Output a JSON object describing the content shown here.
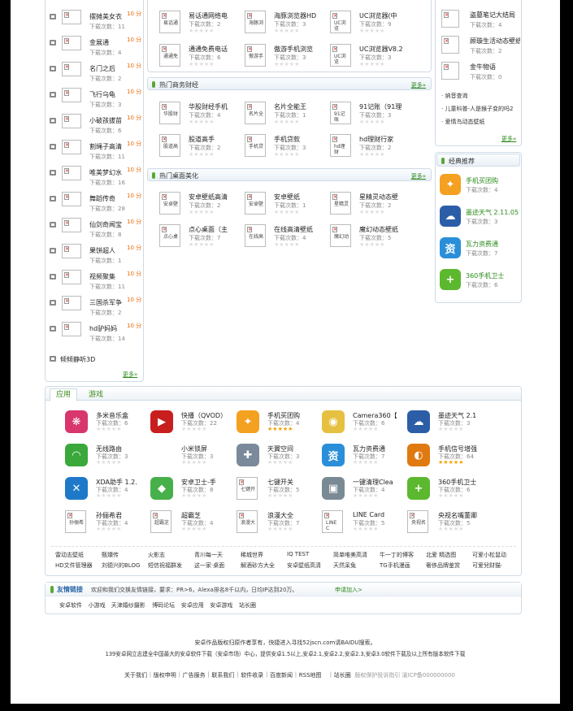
{
  "labels": {
    "hot": "10 分",
    "more": "更多»",
    "count_prefix": "下载次数：",
    "stars_glyph": "★★★★★"
  },
  "left_list": [
    {
      "name": "摆摊美女衣",
      "count": "11",
      "hot": true
    },
    {
      "name": "金展通",
      "count": "4",
      "hot": true
    },
    {
      "name": "名门之后",
      "count": "2",
      "hot": true
    },
    {
      "name": "飞行乌龟",
      "count": "3",
      "hot": true
    },
    {
      "name": "小破孩拔苗",
      "count": "6",
      "hot": true
    },
    {
      "name": "割绳子高清",
      "count": "11",
      "hot": true
    },
    {
      "name": "唯美梦幻水",
      "count": "16",
      "hot": true
    },
    {
      "name": "舞蹈传奇",
      "count": "28",
      "hot": true
    },
    {
      "name": "仙剑奇闻宝",
      "count": "8",
      "hot": true
    },
    {
      "name": "果饼超人",
      "count": "1",
      "hot": true
    },
    {
      "name": "视频聚集",
      "count": "11",
      "hot": true
    },
    {
      "name": "三国杀军争",
      "count": "2",
      "hot": true
    },
    {
      "name": "hd驴妈妈",
      "count": "14",
      "hot": true
    }
  ],
  "left_last": "倾倾静听3D",
  "mid_top_rows": [
    [
      {
        "name": "易话通网络电",
        "count": "2",
        "ph": "易话通"
      },
      {
        "name": "海豚浏览器HD",
        "count": "3",
        "ph": "海豚浏"
      },
      {
        "name": "UC浏览器(中",
        "count": "9",
        "ph": "UC浏览"
      }
    ],
    [
      {
        "name": "通通免费电话",
        "count": "6",
        "ph": "通通免"
      },
      {
        "name": "傲游手机浏览",
        "count": "3",
        "ph": "傲游手"
      },
      {
        "name": "UC浏览器V8.2",
        "count": "3",
        "ph": "UC浏览"
      }
    ]
  ],
  "sec_business": {
    "title": "热门商务财经",
    "rows": [
      [
        {
          "name": "华股财经手机",
          "count": "4",
          "ph": "华股财"
        },
        {
          "name": "名片全能王",
          "count": "1",
          "ph": "名片全"
        },
        {
          "name": "91记账（91理",
          "count": "3",
          "ph": "91记账"
        }
      ],
      [
        {
          "name": "股道高手",
          "count": "2",
          "ph": "股道高"
        },
        {
          "name": "手机贷款",
          "count": "3",
          "ph": "手机贷"
        },
        {
          "name": "hd理财行家",
          "count": "2",
          "ph": "hd理财"
        }
      ]
    ]
  },
  "sec_desktop": {
    "title": "热门桌面美化",
    "rows": [
      [
        {
          "name": "安卓壁纸高清",
          "count": "2",
          "ph": "安卓壁"
        },
        {
          "name": "安卓壁纸",
          "count": "1",
          "ph": "安卓壁"
        },
        {
          "name": "星精灵动态壁",
          "count": "2",
          "ph": "星精灵"
        }
      ],
      [
        {
          "name": "点心桌面（主",
          "count": "7",
          "ph": "点心桌"
        },
        {
          "name": "在线高清壁纸",
          "count": "4",
          "ph": "在线高"
        },
        {
          "name": "魔幻动态壁纸",
          "count": "5",
          "ph": "魔幻动"
        }
      ]
    ]
  },
  "right_top": [
    {
      "name": "盗墓笔记大结局",
      "count": "4"
    },
    {
      "name": "顾璇生活动态壁纸",
      "count": "2"
    },
    {
      "name": "金牛物语",
      "count": "0"
    }
  ],
  "right_links": [
    "纳音查询",
    "儿童科普-人是猴子变的吗2",
    "爱情鸟动态壁纸"
  ],
  "classic": {
    "title": "经典推荐",
    "items": [
      {
        "name": "手机买团购",
        "count": "4",
        "icon_color": "#f4a020",
        "icon_glyph": "✦"
      },
      {
        "name": "墨迹天气 2.11.05",
        "count": "3",
        "icon_color": "#2c5ea8",
        "icon_glyph": "☁"
      },
      {
        "name": "瓦力资费通",
        "count": "7",
        "icon_color": "#2a8fd8",
        "icon_glyph": "资"
      },
      {
        "name": "360手机卫士",
        "count": "6",
        "icon_color": "#5cb82e",
        "icon_glyph": "+"
      }
    ]
  },
  "bottom_tabs": [
    "应用",
    "游戏"
  ],
  "bottom_rows": [
    [
      {
        "name": "多米音乐盒",
        "count": "6",
        "icon": "#d8366c",
        "glyph": "❋",
        "rate": 0
      },
      {
        "name": "快播（QVOD）",
        "count": "22",
        "icon": "#c81e1e",
        "glyph": "▶",
        "rate": 0
      },
      {
        "name": "手机买团购",
        "count": "4",
        "icon": "#f4a020",
        "glyph": "✦",
        "rate": 5
      },
      {
        "name": "Camera360【",
        "count": "6",
        "icon": "#e6c040",
        "glyph": "◉",
        "rate": 0
      },
      {
        "name": "墨迹天气 2.1",
        "count": "3",
        "icon": "#2c5ea8",
        "glyph": "☁",
        "rate": 0
      }
    ],
    [
      {
        "name": "无线路由",
        "count": "3",
        "icon": "#3aa83a",
        "glyph": "◠",
        "rate": 0
      },
      {
        "name": "小米锁屏",
        "count": "3",
        "icon": "",
        "glyph": "",
        "rate": 0
      },
      {
        "name": "天翼空间",
        "count": "3",
        "icon": "#7a8a9a",
        "glyph": "✚",
        "rate": 0
      },
      {
        "name": "瓦力资费通",
        "count": "7",
        "icon": "#2a8fd8",
        "glyph": "资",
        "rate": 0
      },
      {
        "name": "手机信号增强",
        "count": "64",
        "icon": "#e07a10",
        "glyph": "◐",
        "rate": 5
      }
    ],
    [
      {
        "name": "XDA助手 1.2.",
        "count": "4",
        "icon": "#1e7ac8",
        "glyph": "✕",
        "rate": 0
      },
      {
        "name": "安卓卫士-手",
        "count": "8",
        "icon": "#48b04a",
        "glyph": "◆",
        "rate": 0
      },
      {
        "name": "七键开关",
        "count": "5",
        "icon": "",
        "glyph": "",
        "ph": "七键开",
        "rate": 0
      },
      {
        "name": "一键清理Clea",
        "count": "4",
        "icon": "#7a8a94",
        "glyph": "▣",
        "rate": 0
      },
      {
        "name": "360手机卫士",
        "count": "6",
        "icon": "#5cb82e",
        "glyph": "+",
        "rate": 0
      }
    ],
    [
      {
        "name": "孙俪希君",
        "count": "4",
        "icon": "",
        "glyph": "",
        "ph": "孙俪希",
        "rate": 0
      },
      {
        "name": "超霸芝",
        "count": "4",
        "icon": "",
        "glyph": "",
        "ph": "超霸芝",
        "rate": 0
      },
      {
        "name": "浪漫大全",
        "count": "7",
        "icon": "",
        "glyph": "",
        "ph": "浪漫大",
        "rate": 0
      },
      {
        "name": "LINE Card",
        "count": "5",
        "icon": "",
        "glyph": "",
        "ph": "LINE C",
        "rate": 0
      },
      {
        "name": "央视名嘴董卿",
        "count": "5",
        "icon": "",
        "glyph": "",
        "ph": "央视名",
        "rate": 0
      }
    ]
  ],
  "tag_rows": [
    [
      "雷动志壁纸",
      "甄嬛传",
      "火影志",
      "青川每一天",
      "稀城世界",
      "IQ TEST",
      "简单唯美高清",
      "牛一丁的博客",
      "北爱 精选图",
      "可爱小松鼠动"
    ],
    [
      "HD文件管理器",
      "刘德兴的BLOG",
      "短信祝福群发",
      "这一家·桌面",
      "解酒砂方大全",
      "安卓壁纸高清",
      "天然呆兔",
      "TG手机漫画",
      "奢侈品牌鉴赏",
      "可爱兒财猫·"
    ]
  ],
  "friend_links": {
    "title": "友情链接",
    "desc": "欢迎和我们交换友情链接，要求：PR>6，Alexa排名8千以内，日均IP达到20万。",
    "apply": "申请加入>",
    "links": [
      "安卓软件",
      "小游戏",
      "天津婚纱摄影",
      "博码论坛",
      "安卓应用",
      "安卓游戏",
      "站长圈"
    ]
  },
  "footer": {
    "line1": "安卓作品版权归原作者享有，快捷进入寻找52jscn.com请BAIDU搜索。",
    "line2": "139安卓网立志建全中国最大的安卓软件下载（安卓市场）中心，提供安卓1.5以上,安卓2.1,安卓2.2,安卓2.3,安卓3.0软件下载及以上所有版本软件下载",
    "nav": [
      "关于我们",
      "版权申明",
      "广告服务",
      "联系我们",
      "软件收录",
      "百度新闻",
      "RSS地图",
      "站长圈"
    ],
    "icp": "版权保护投诉指引 渝ICP备000000000"
  }
}
